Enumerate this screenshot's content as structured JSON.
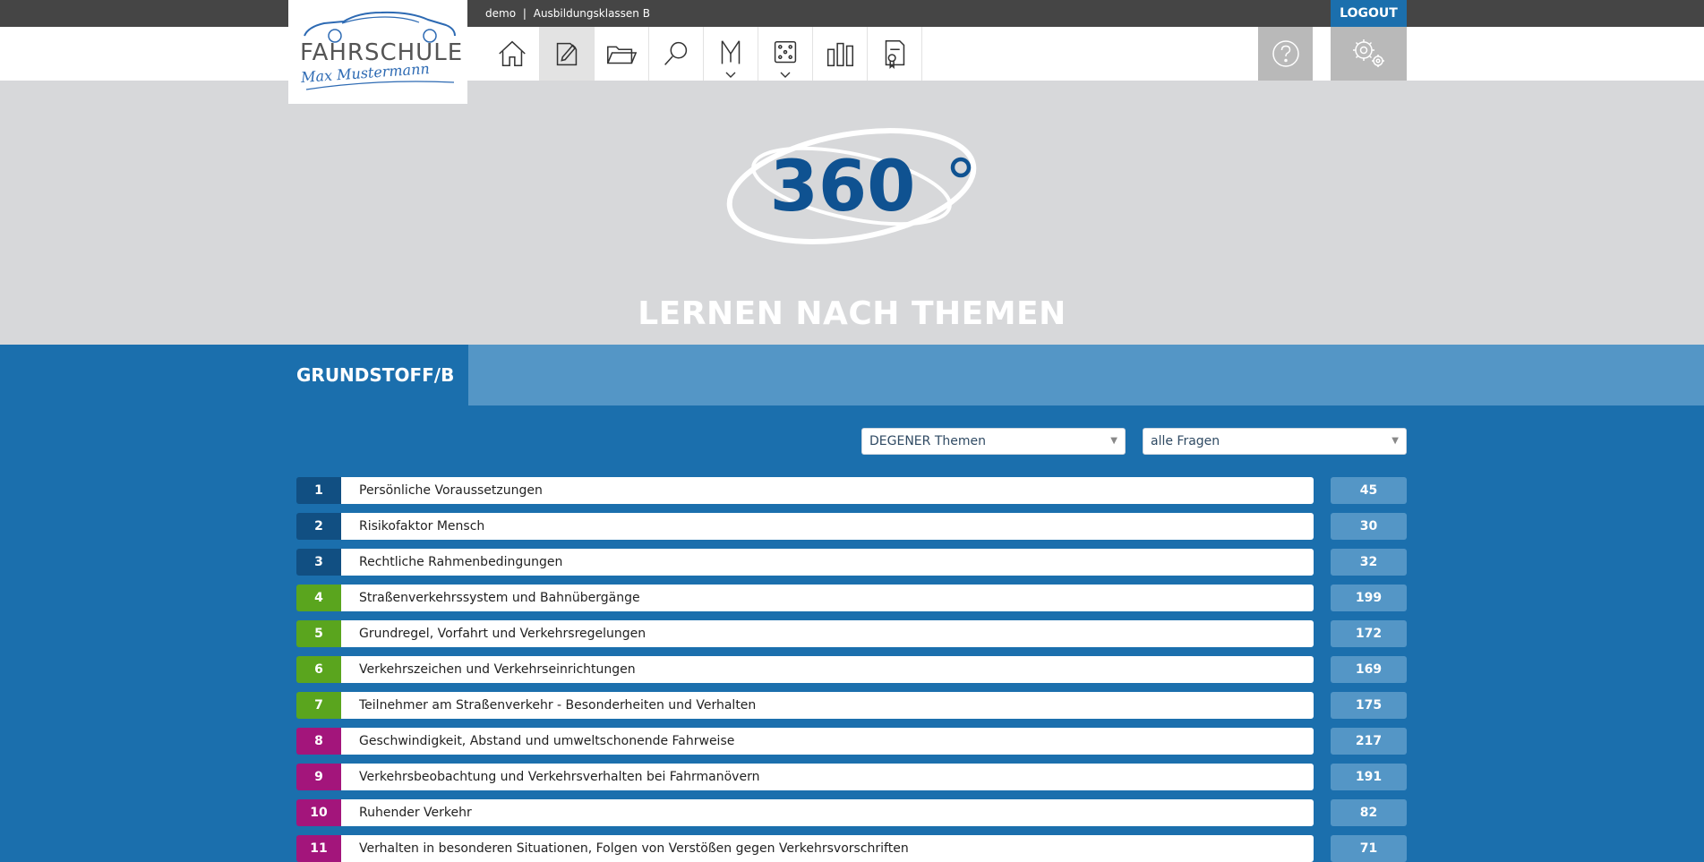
{
  "header": {
    "username": "demo",
    "separator": "|",
    "license_class": "Ausbildungsklassen B",
    "logout_label": "LOGOUT"
  },
  "logo": {
    "title": "FAHRSCHULE",
    "script": "Max Mustermann"
  },
  "nav": {
    "items": [
      {
        "icon": "home-icon",
        "active": false
      },
      {
        "icon": "edit-document-icon",
        "active": true
      },
      {
        "icon": "folder-icon",
        "active": false
      },
      {
        "icon": "search-icon",
        "active": false
      },
      {
        "icon": "exam-dropdown-icon",
        "active": false
      },
      {
        "icon": "dice-dropdown-icon",
        "active": false
      },
      {
        "icon": "statistics-icon",
        "active": false
      },
      {
        "icon": "certificate-icon",
        "active": false
      }
    ],
    "help_icon": "help-icon",
    "settings_icon": "settings-icon"
  },
  "hero": {
    "logo_text": "360",
    "title": "LERNEN NACH THEMEN"
  },
  "section": {
    "title": "GRUNDSTOFF/B"
  },
  "filters": {
    "topic_set": "DEGENER Themen",
    "question_filter": "alle Fragen"
  },
  "colors": {
    "category_blue": "#114f82",
    "category_green": "#5aa51e",
    "category_magenta": "#a3157b",
    "page_blue": "#1b6fad",
    "light_blue": "#5496c6"
  },
  "topics": [
    {
      "num": "1",
      "label": "Persönliche Voraussetzungen",
      "count": "45",
      "color": "#114f82"
    },
    {
      "num": "2",
      "label": "Risikofaktor Mensch",
      "count": "30",
      "color": "#114f82"
    },
    {
      "num": "3",
      "label": "Rechtliche Rahmenbedingungen",
      "count": "32",
      "color": "#114f82"
    },
    {
      "num": "4",
      "label": "Straßenverkehrssystem und Bahnübergänge",
      "count": "199",
      "color": "#5aa51e"
    },
    {
      "num": "5",
      "label": "Grundregel, Vorfahrt und Verkehrsregelungen",
      "count": "172",
      "color": "#5aa51e"
    },
    {
      "num": "6",
      "label": "Verkehrszeichen und Verkehrseinrichtungen",
      "count": "169",
      "color": "#5aa51e"
    },
    {
      "num": "7",
      "label": "Teilnehmer am Straßenverkehr - Besonderheiten und Verhalten",
      "count": "175",
      "color": "#5aa51e"
    },
    {
      "num": "8",
      "label": "Geschwindigkeit, Abstand und umweltschonende Fahrweise",
      "count": "217",
      "color": "#a3157b"
    },
    {
      "num": "9",
      "label": "Verkehrsbeobachtung und Verkehrsverhalten bei Fahrmanövern",
      "count": "191",
      "color": "#a3157b"
    },
    {
      "num": "10",
      "label": "Ruhender Verkehr",
      "count": "82",
      "color": "#a3157b"
    },
    {
      "num": "11",
      "label": "Verhalten in besonderen Situationen, Folgen von Verstößen gegen Verkehrsvorschriften",
      "count": "71",
      "color": "#a3157b"
    }
  ]
}
